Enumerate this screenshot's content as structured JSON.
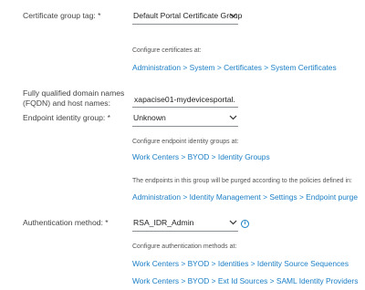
{
  "certificate_group": {
    "label": "Certificate group tag: *",
    "selected": "Default Portal Certificate Group",
    "help": "Configure certificates at:",
    "link": "Administration > System > Certificates > System Certificates"
  },
  "fqdn": {
    "label_line1": "Fully qualified domain names",
    "label_line2": "(FQDN) and host names:",
    "value": "xapacise01-mydevicesportal."
  },
  "endpoint_identity_group": {
    "label": "Endpoint identity group: *",
    "selected": "Unknown",
    "help": "Configure endpoint identity groups at:",
    "link": "Work Centers > BYOD > Identity Groups",
    "purge_help": "The endpoints in this group will be purged according to the policies defined in:",
    "purge_link": "Administration > Identity Management > Settings > Endpoint purge"
  },
  "authentication_method": {
    "label": "Authentication method: *",
    "selected": "RSA_IDR_Admin",
    "info_glyph": "i",
    "help": "Configure authentication methods at:",
    "link1": "Work Centers > BYOD > Identities > Identity Source Sequences",
    "link2": "Work Centers > BYOD > Ext Id Sources > SAML Identity Providers"
  },
  "icons": {
    "dropdown": "chevron-down-icon",
    "info": "info-icon"
  },
  "colors": {
    "link": "#1a7ec5",
    "label": "#444444",
    "underline": "#8a8f94"
  }
}
